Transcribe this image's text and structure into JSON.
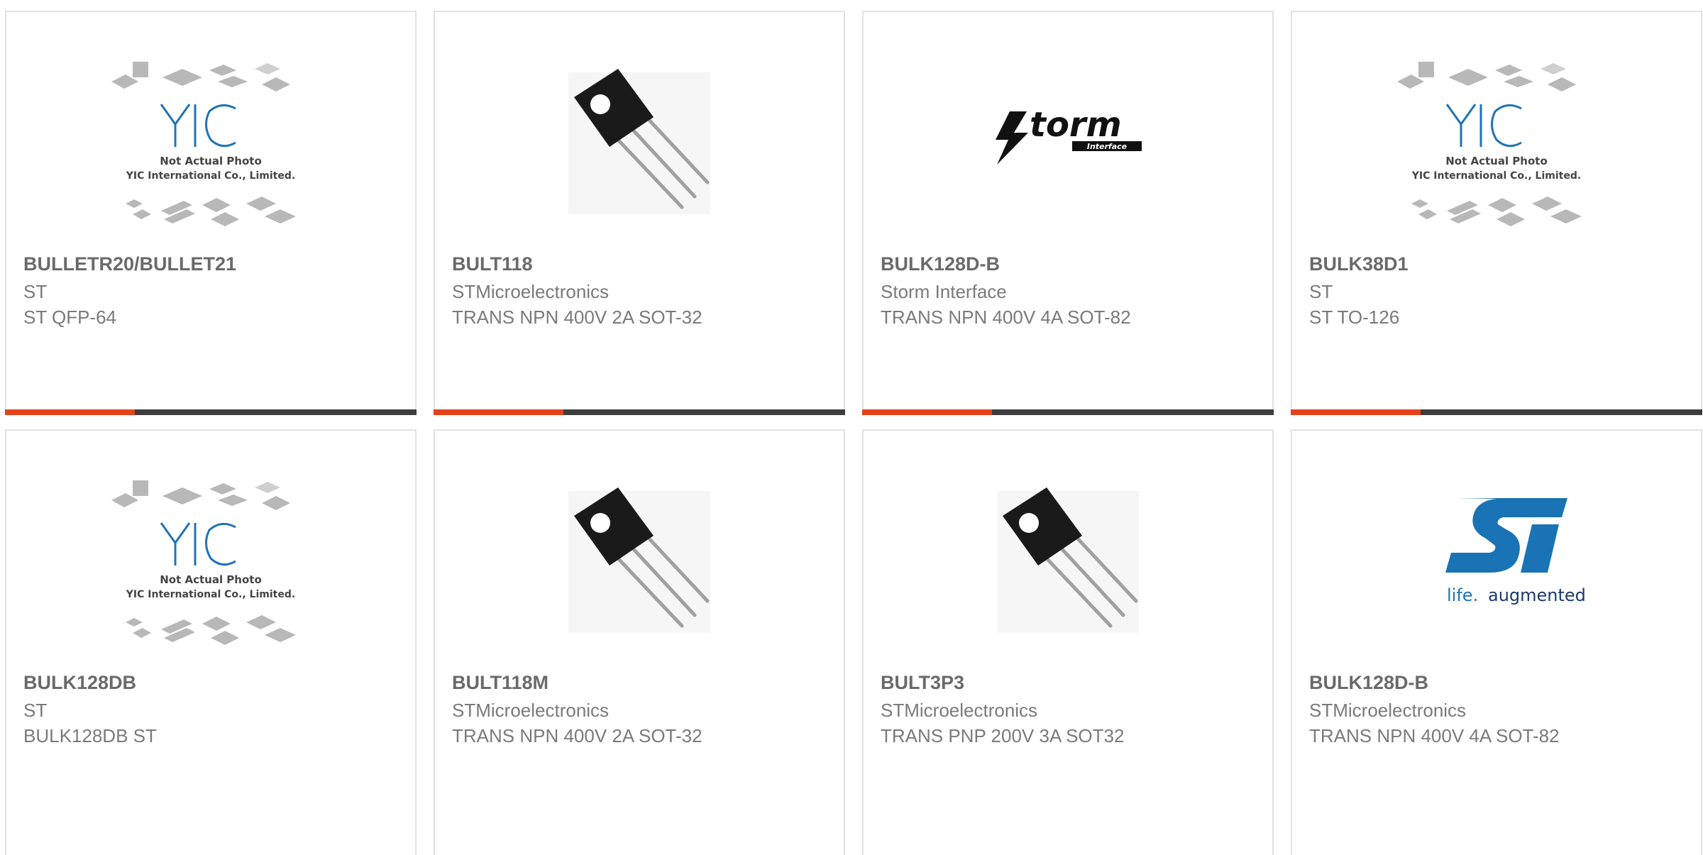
{
  "products": [
    {
      "part": "BULLETR20/BULLET21",
      "manufacturer": "ST",
      "description": "ST QFP-64",
      "image": "yic-placeholder",
      "placeholder_lines": [
        "Not Actual Photo",
        "YIC International Co., Limited."
      ]
    },
    {
      "part": "BULT118",
      "manufacturer": "STMicroelectronics",
      "description": "TRANS NPN 400V 2A SOT-32",
      "image": "to-126-transistor"
    },
    {
      "part": "BULK128D-B",
      "manufacturer": "Storm Interface",
      "description": "TRANS NPN 400V 4A SOT-82",
      "image": "storm-interface-logo",
      "logo_text": {
        "main": "torm",
        "sub": "Interface"
      }
    },
    {
      "part": "BULK38D1",
      "manufacturer": "ST",
      "description": "ST TO-126",
      "image": "yic-placeholder",
      "placeholder_lines": [
        "Not Actual Photo",
        "YIC International Co., Limited."
      ]
    },
    {
      "part": "BULK128DB",
      "manufacturer": "ST",
      "description": "BULK128DB ST",
      "image": "yic-placeholder",
      "placeholder_lines": [
        "Not Actual Photo",
        "YIC International Co., Limited."
      ]
    },
    {
      "part": "BULT118M",
      "manufacturer": "STMicroelectronics",
      "description": "TRANS NPN 400V 2A SOT-32",
      "image": "to-126-transistor"
    },
    {
      "part": "BULT3P3",
      "manufacturer": "STMicroelectronics",
      "description": "TRANS PNP 200V 3A SOT32",
      "image": "to-126-transistor"
    },
    {
      "part": "BULK128D-B",
      "manufacturer": "STMicroelectronics",
      "description": "TRANS NPN 400V 4A SOT-82",
      "image": "st-logo",
      "logo_text": {
        "pre": "life.",
        "post": "augmented"
      }
    }
  ],
  "colors": {
    "accent": "#e5421b",
    "bar": "#3d3d3d",
    "text": "#7a7a7a",
    "yic_blue": "#1f73b7",
    "st_blue": "#1a73b5"
  }
}
